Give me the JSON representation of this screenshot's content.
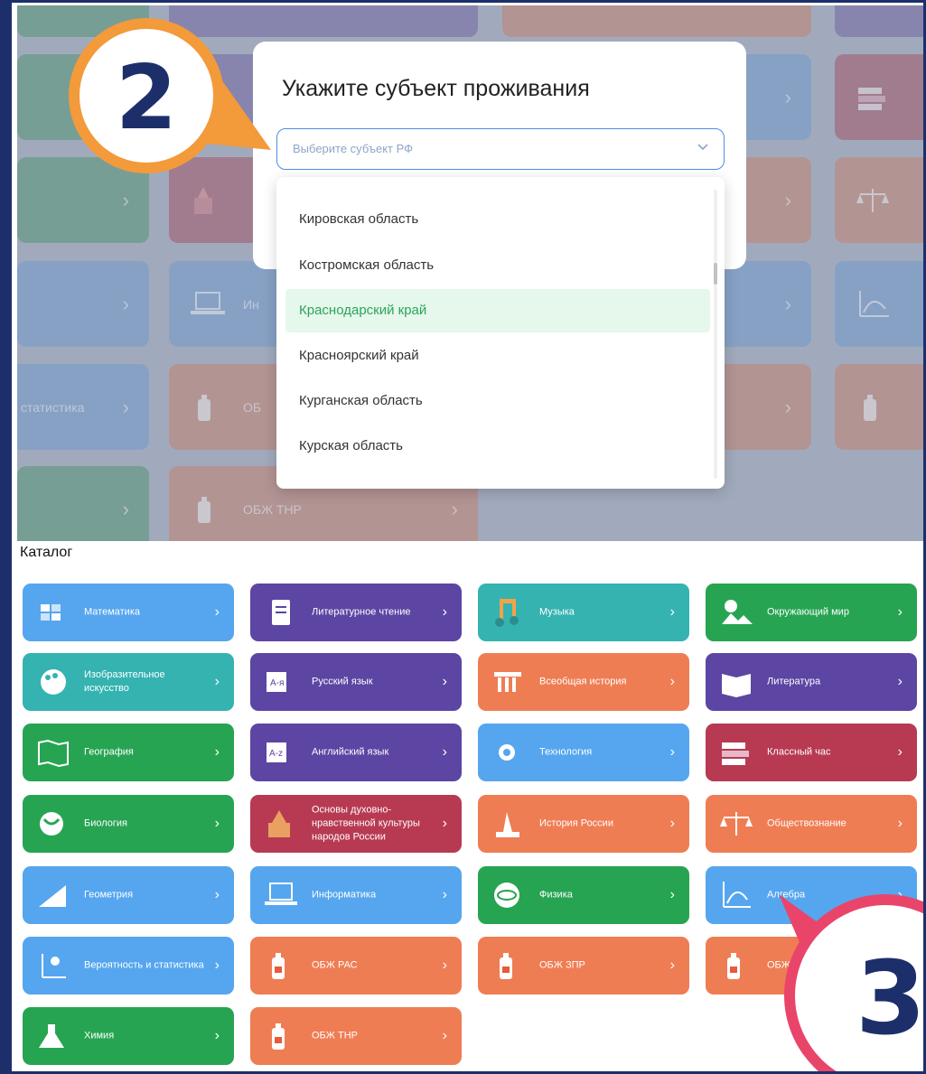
{
  "modal": {
    "title": "Укажите субъект проживания",
    "select_placeholder": "Выберите субъект РФ",
    "options": [
      {
        "label": "Кировская область",
        "selected": false
      },
      {
        "label": "Костромская область",
        "selected": false
      },
      {
        "label": "Краснодарский край",
        "selected": true
      },
      {
        "label": "Красноярский край",
        "selected": false
      },
      {
        "label": "Курганская область",
        "selected": false
      },
      {
        "label": "Курская область",
        "selected": false
      }
    ]
  },
  "background_tiles": {
    "label_info": "Ин",
    "label_stat": "статистика",
    "label_obzh": "ОБ",
    "label_obzh_thr": "ОБЖ ТНР"
  },
  "callouts": {
    "step2": "2",
    "step3": "3"
  },
  "catalog": {
    "title": "Каталог",
    "tiles": [
      {
        "label": "Математика",
        "color": "#55a6ef",
        "icon": "math-icon"
      },
      {
        "label": "Литературное чтение",
        "color": "#5c45a3",
        "icon": "reading-icon"
      },
      {
        "label": "Музыка",
        "color": "#34b3b1",
        "icon": "music-icon"
      },
      {
        "label": "Окружающий мир",
        "color": "#27a452",
        "icon": "nature-icon"
      },
      {
        "label": "Изобразительное искусство",
        "color": "#34b3b1",
        "icon": "palette-icon"
      },
      {
        "label": "Русский язык",
        "color": "#5c45a3",
        "icon": "russian-icon"
      },
      {
        "label": "Всеобщая история",
        "color": "#ef7d54",
        "icon": "column-icon"
      },
      {
        "label": "Литература",
        "color": "#5c45a3",
        "icon": "book-icon"
      },
      {
        "label": "География",
        "color": "#27a452",
        "icon": "map-icon"
      },
      {
        "label": "Английский язык",
        "color": "#5c45a3",
        "icon": "english-icon"
      },
      {
        "label": "Технология",
        "color": "#55a6ef",
        "icon": "gear-icon"
      },
      {
        "label": "Классный час",
        "color": "#b73a52",
        "icon": "books-icon"
      },
      {
        "label": "Биология",
        "color": "#27a452",
        "icon": "biology-icon"
      },
      {
        "label": "Основы духовно-нравственной культуры народов России",
        "color": "#b73a52",
        "icon": "church-icon"
      },
      {
        "label": "История России",
        "color": "#ef7d54",
        "icon": "monument-icon"
      },
      {
        "label": "Обществознание",
        "color": "#ef7d54",
        "icon": "scales-icon"
      },
      {
        "label": "Геометрия",
        "color": "#55a6ef",
        "icon": "ruler-icon"
      },
      {
        "label": "Информатика",
        "color": "#55a6ef",
        "icon": "laptop-icon"
      },
      {
        "label": "Физика",
        "color": "#27a452",
        "icon": "atom-icon"
      },
      {
        "label": "Алгебра",
        "color": "#55a6ef",
        "icon": "graph-icon"
      },
      {
        "label": "Вероятность и статистика",
        "color": "#55a6ef",
        "icon": "probability-icon"
      },
      {
        "label": "ОБЖ РАС",
        "color": "#ef7d54",
        "icon": "extinguisher-icon"
      },
      {
        "label": "ОБЖ ЗПР",
        "color": "#ef7d54",
        "icon": "extinguisher-icon"
      },
      {
        "label": "ОБЖ",
        "color": "#ef7d54",
        "icon": "extinguisher-icon"
      },
      {
        "label": "Химия",
        "color": "#27a452",
        "icon": "flask-icon"
      },
      {
        "label": "ОБЖ ТНР",
        "color": "#ef7d54",
        "icon": "extinguisher-icon"
      }
    ]
  }
}
